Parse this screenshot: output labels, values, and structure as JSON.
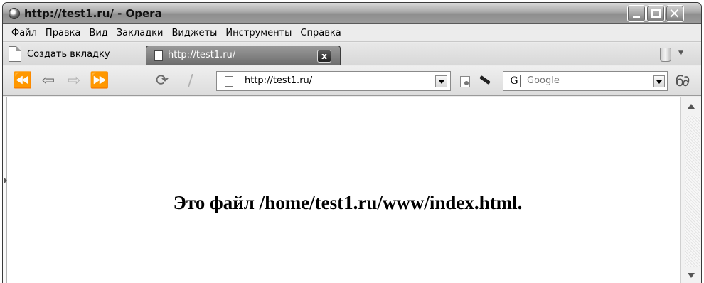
{
  "window": {
    "title": "http://test1.ru/ - Opera",
    "icon": "opera-icon",
    "buttons": {
      "minimize": "minimize-icon",
      "maximize": "maximize-icon",
      "close": "close-icon"
    }
  },
  "menu": {
    "items": [
      "Файл",
      "Правка",
      "Вид",
      "Закладки",
      "Виджеты",
      "Инструменты",
      "Справка"
    ]
  },
  "tabs": {
    "new_tab_label": "Создать вкладку",
    "active_tab_label": "http://test1.ru/",
    "close_glyph": "x",
    "trash_icon": "trash-icon"
  },
  "toolbar": {
    "address": "http://test1.ru/",
    "search_engine_letter": "G",
    "search_placeholder": "Google",
    "buttons": [
      "rewind-icon",
      "back-icon",
      "forward-icon",
      "fast-forward-icon",
      "reload-icon",
      "edit-icon",
      "feed-icon",
      "wand-icon",
      "glasses-icon"
    ]
  },
  "content": {
    "heading": "Это файл /home/test1.ru/www/index.html."
  },
  "colors": {
    "titlebar": "#9c9c9c",
    "active_tab": "#6c6c6c",
    "background": "#ececec"
  }
}
